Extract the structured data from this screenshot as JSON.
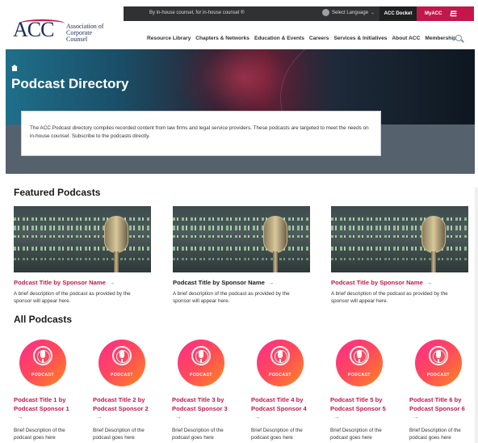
{
  "header": {
    "tagline": "By in-house counsel, for in-house counsel ®",
    "language": "Select Language",
    "docket": "ACC Docket",
    "myacc": "MyACC",
    "logo_acc": "ACC",
    "logo_name_1": "Association of",
    "logo_name_2": "Corporate Counsel",
    "nav": [
      "Resource Library",
      "Chapters & Networks",
      "Education & Events",
      "Careers",
      "Services & Initiatives",
      "About ACC",
      "Membership"
    ]
  },
  "hero": {
    "title": "Podcast Directory",
    "intro": "The ACC Podcast directory compiles recorded content from law firms and legal service providers. These podcasts are targeted to meet the needs on in-house counsel. Subscribe to the podcasts directly."
  },
  "featured": {
    "heading": "Featured Podcasts",
    "items": [
      {
        "title": "Podcast Title by Sponsor Name",
        "desc": "A brief description of the podcast as provided by the sponsor will appear here."
      },
      {
        "title": "Podcast Title by Sponsor Name",
        "desc": "A brief description of the podcast as provided by the sponsor will appear here."
      },
      {
        "title": "Podcast Title by Sponsor Name",
        "desc": "A brief description of the podcast as provided by the sponsor will appear here."
      }
    ]
  },
  "all": {
    "heading": "All Podcasts",
    "badge_label": "PODCAST",
    "items": [
      {
        "title": "Podcast Title 1 by Podcast Sponsor 1",
        "desc": "Brief Description of the podcast goes here"
      },
      {
        "title": "Podcast Title 2 by Podcast Sponsor 2",
        "desc": "Brief Description of the podcast goes here"
      },
      {
        "title": "Podcast Title 3 by Podcast Sponsor 3",
        "desc": "Brief Description of the podcast goes here"
      },
      {
        "title": "Podcast Title 4 by Podcast Sponsor 4",
        "desc": "Brief Description of the podcast goes here"
      },
      {
        "title": "Podcast Title 5 by Podcast Sponsor 5",
        "desc": "Brief Description of the podcast goes here"
      },
      {
        "title": "Podcast Title 6 by Podcast Sponsor 6",
        "desc": "Brief Description of the podcast goes here"
      }
    ]
  },
  "arrow": "→",
  "colors": {
    "brand": "#c1184b",
    "navy": "#1d2c52",
    "topbar": "#2f3133"
  }
}
